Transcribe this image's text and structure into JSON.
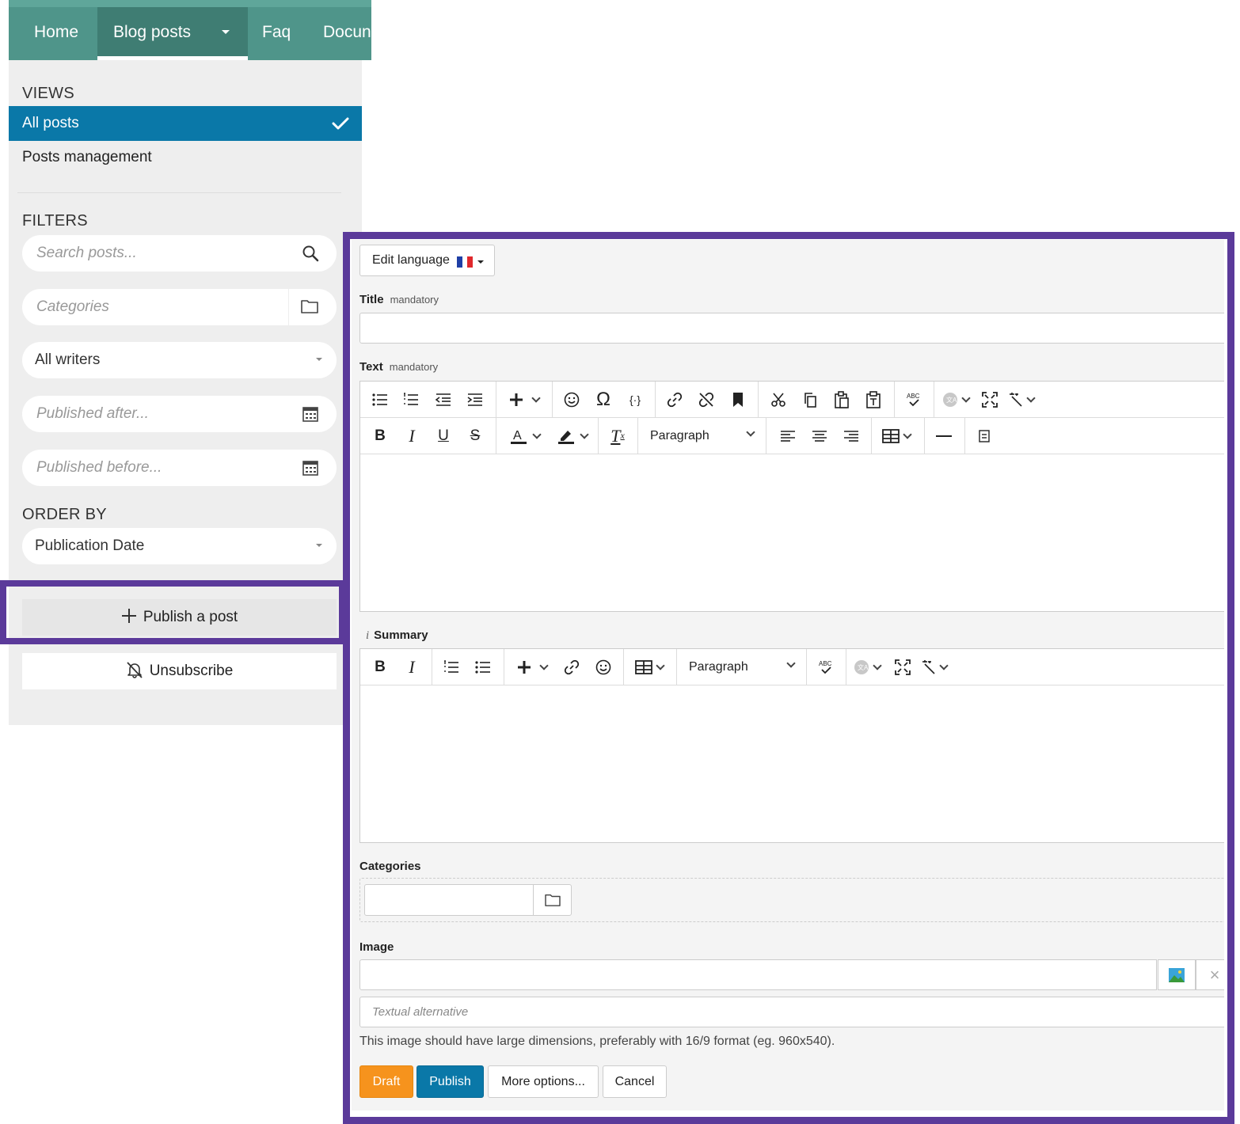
{
  "nav": {
    "items": [
      "Home",
      "Blog posts",
      "Faq",
      "Docun"
    ],
    "active_index": 1,
    "colors": {
      "bar": "#4f958a",
      "active": "#3f7d73"
    }
  },
  "sidebar": {
    "views_title": "VIEWS",
    "views": [
      {
        "label": "All posts",
        "selected": true
      },
      {
        "label": "Posts management",
        "selected": false
      }
    ],
    "filters_title": "FILTERS",
    "search_placeholder": "Search posts...",
    "categories_placeholder": "Categories",
    "writers_select": "All writers",
    "published_after_placeholder": "Published after...",
    "published_before_placeholder": "Published before...",
    "order_title": "ORDER BY",
    "order_select": "Publication Date",
    "publish_button": "Publish a post",
    "unsubscribe_button": "Unsubscribe",
    "icons": [
      "check-icon",
      "search-icon",
      "folder-icon",
      "calendar-icon",
      "plus-icon",
      "bell-off-icon"
    ],
    "accent_color": "#0a78a8"
  },
  "editor": {
    "edit_language_button": "Edit language",
    "language_flag": "fr-flag-icon",
    "title_label": "Title",
    "title_required": "mandatory",
    "text_label": "Text",
    "text_required": "mandatory",
    "paragraph_format": "Paragraph",
    "summary_label": "Summary",
    "summary_paragraph_format": "Paragraph",
    "categories_label": "Categories",
    "image_label": "Image",
    "alt_placeholder": "Textual alternative",
    "image_hint": "This image should have large dimensions, preferably with 16/9 format (eg. 960x540).",
    "actions": {
      "draft": "Draft",
      "publish": "Publish",
      "more": "More options...",
      "cancel": "Cancel"
    },
    "colors": {
      "draft": "#f6931d",
      "publish": "#0a78a8",
      "highlight": "#5b3a9a"
    }
  }
}
